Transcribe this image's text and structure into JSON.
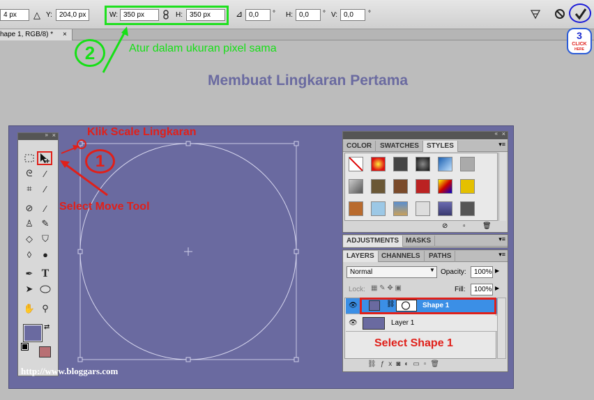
{
  "options_bar": {
    "x_value": "4 px",
    "y_label": "Y:",
    "y_value": "204,0 px",
    "w_label": "W:",
    "w_value": "350 px",
    "h_label": "H:",
    "h_value": "350 px",
    "angle_value": "0,0",
    "deg1": "°",
    "hskew_label": "H:",
    "hskew_value": "0,0",
    "deg2": "°",
    "vskew_label": "V:",
    "vskew_value": "0,0",
    "deg3": "°"
  },
  "document_tab": {
    "title": "hape 1, RGB/8) *",
    "close": "×"
  },
  "annotations": {
    "step2_number": "2",
    "step2_text": "Atur dalam ukuran pixel sama",
    "step3_number": "3",
    "step3_click": "CLICK",
    "step3_here": "HERE",
    "heading": "Membuat Lingkaran Pertama",
    "klik_scale": "Klik Scale Lingkaran",
    "step1_number": "1",
    "select_move": "Select Move Tool",
    "select_shape": "Select Shape 1",
    "watermark": "http://www.bloggars.com"
  },
  "styles_panel": {
    "tabs": [
      "COLOR",
      "SWATCHES",
      "STYLES"
    ],
    "active_tab": "STYLES"
  },
  "adjustments_panel": {
    "tabs": [
      "ADJUSTMENTS",
      "MASKS"
    ]
  },
  "layers_panel": {
    "tabs": [
      "LAYERS",
      "CHANNELS",
      "PATHS"
    ],
    "blend_mode": "Normal",
    "opacity_label": "Opacity:",
    "opacity_value": "100%",
    "lock_label": "Lock:",
    "fill_label": "Fill:",
    "fill_value": "100%",
    "layers": [
      {
        "name": "Shape 1",
        "selected": true
      },
      {
        "name": "Layer 1",
        "selected": false
      }
    ]
  },
  "colors": {
    "canvas": "#6a6aa0",
    "annotation_red": "#e0201a",
    "annotation_green": "#16e016",
    "selected_layer": "#3b8fe6",
    "foreground": "#6a6aa0",
    "background": "#b87074"
  }
}
